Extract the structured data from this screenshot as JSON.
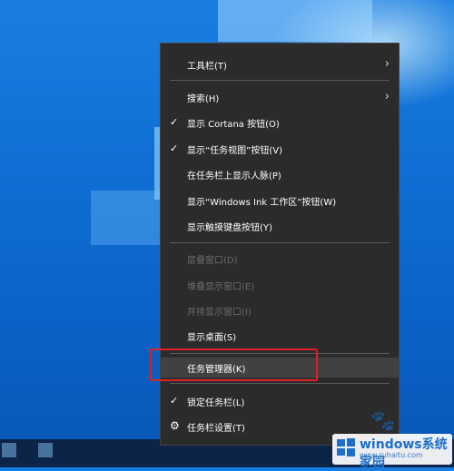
{
  "menu": {
    "items": [
      {
        "label": "工具栏(T)"
      },
      {
        "label": "搜索(H)"
      },
      {
        "label": "显示 Cortana 按钮(O)"
      },
      {
        "label": "显示“任务视图”按钮(V)"
      },
      {
        "label": "在任务栏上显示人脉(P)"
      },
      {
        "label": "显示“Windows Ink 工作区”按钮(W)"
      },
      {
        "label": "显示触摸键盘按钮(Y)"
      },
      {
        "label": "层叠窗口(D)"
      },
      {
        "label": "堆叠显示窗口(E)"
      },
      {
        "label": "并排显示窗口(I)"
      },
      {
        "label": "显示桌面(S)"
      },
      {
        "label": "任务管理器(K)"
      },
      {
        "label": "锁定任务栏(L)"
      },
      {
        "label": "任务栏设置(T)"
      }
    ]
  },
  "watermark": {
    "title": "windows系统家园",
    "subtitle": "www.ruhaitu.com"
  },
  "colors": {
    "menu_bg": "#2b2b2b",
    "hover_bg": "#414141",
    "highlight_border": "#e02020",
    "disabled_text": "#6c6c6c"
  }
}
